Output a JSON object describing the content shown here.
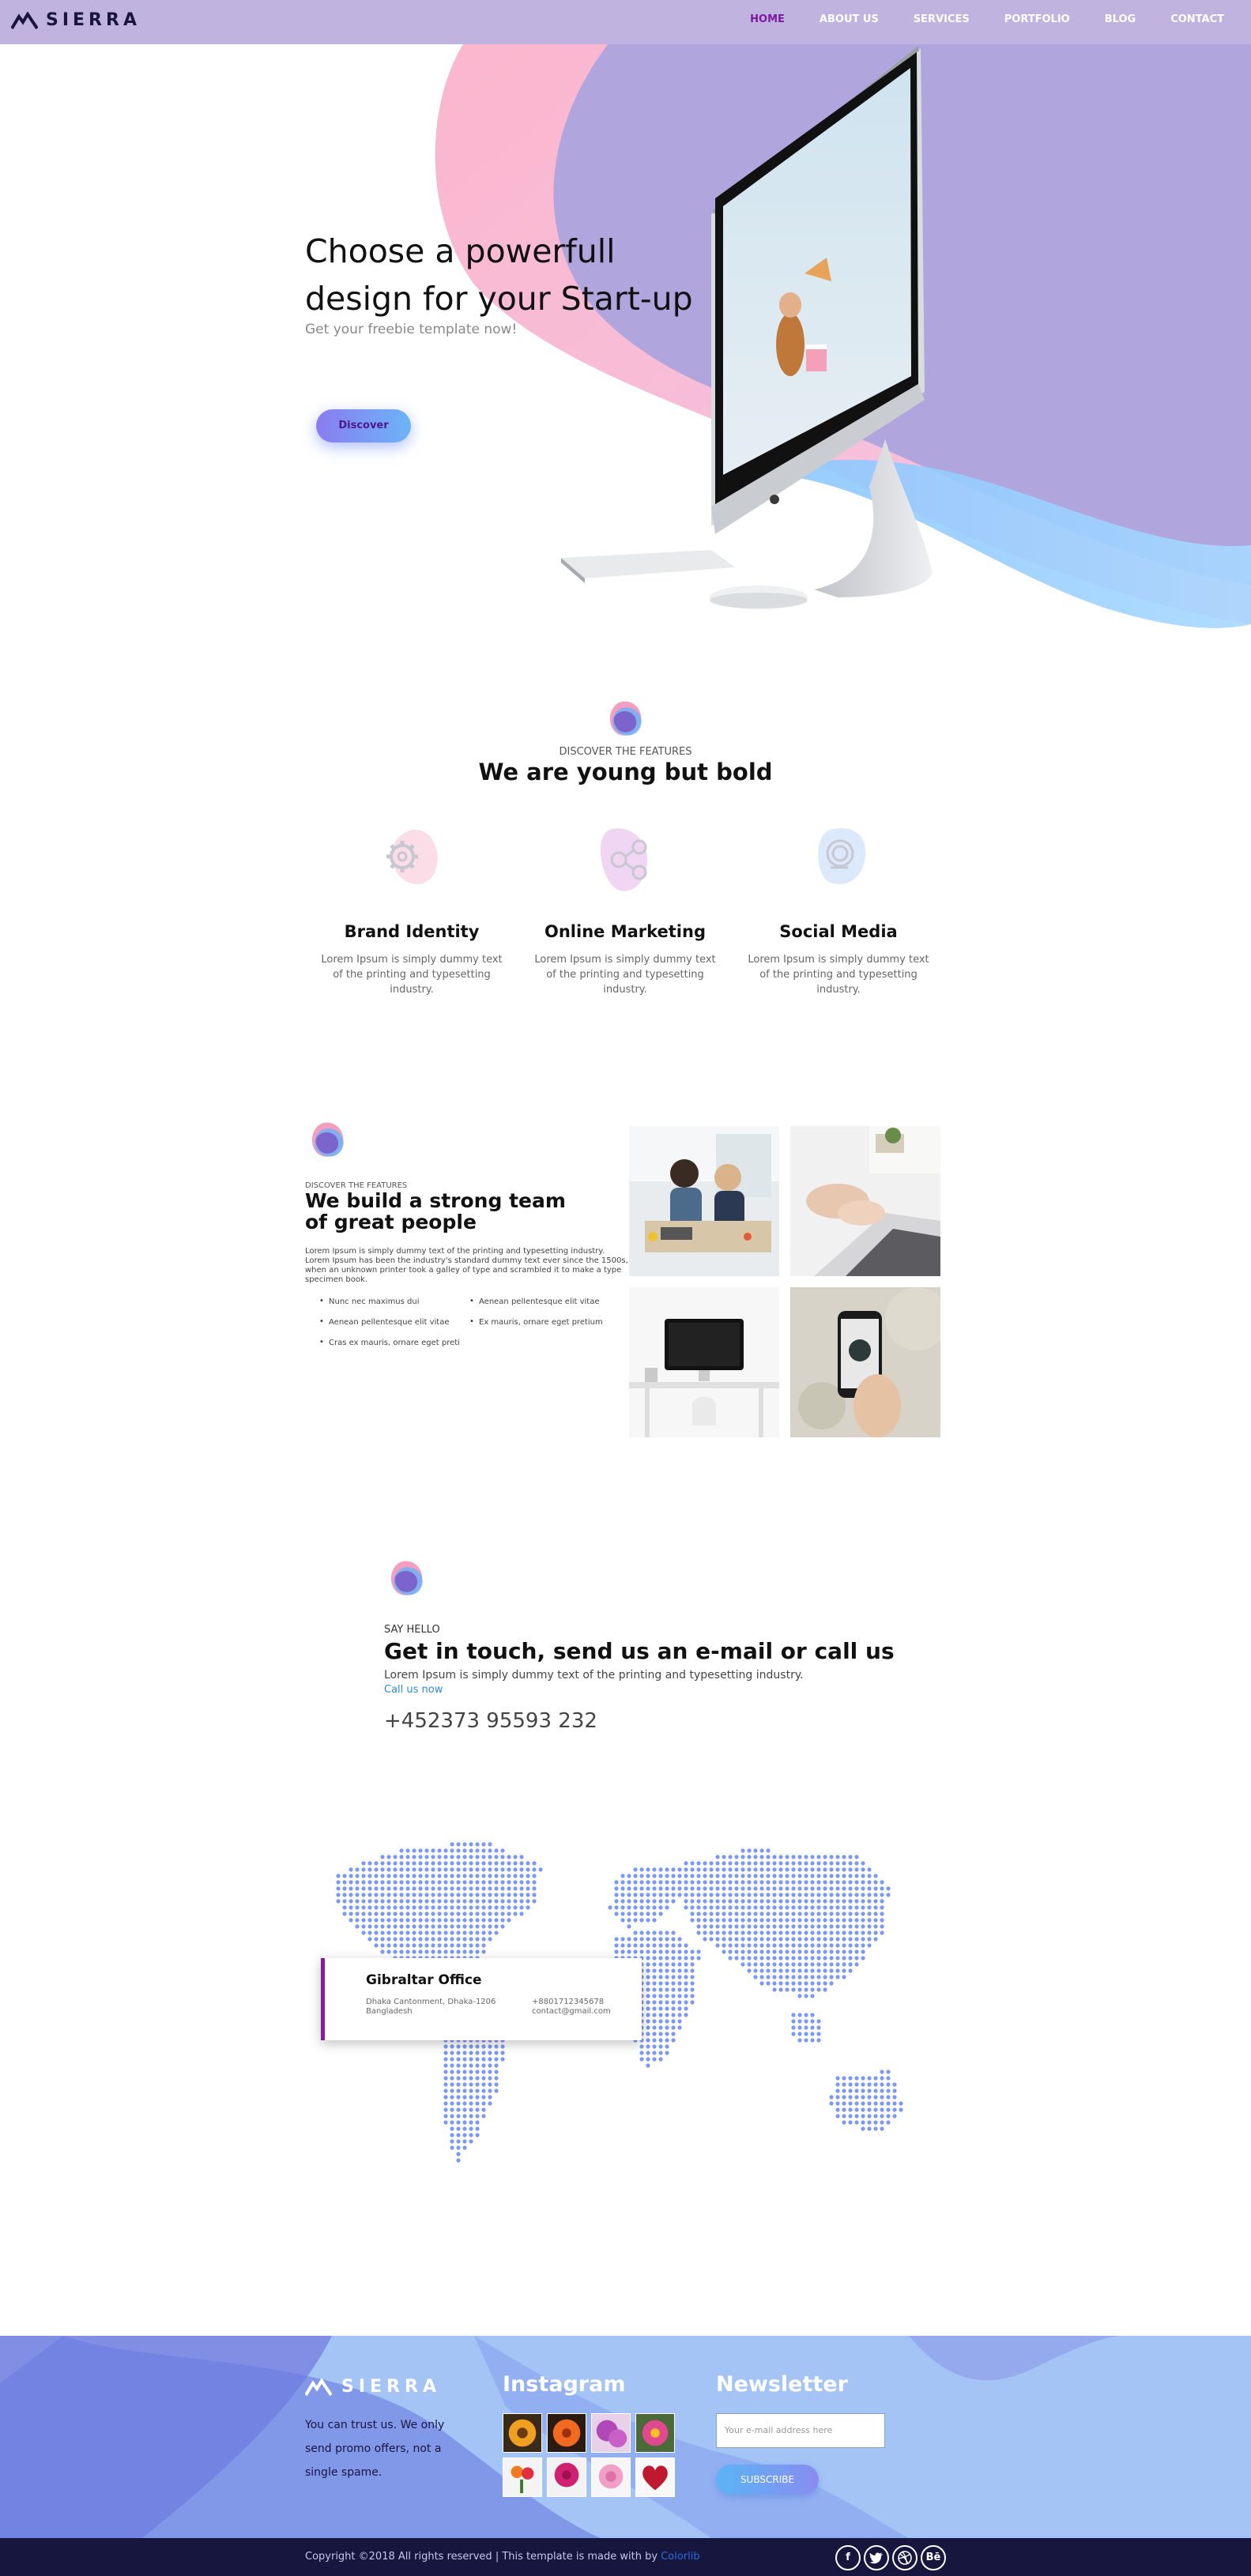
{
  "brand": {
    "name": "SIERRA",
    "logo_icon": "mountain-icon"
  },
  "nav": {
    "items": [
      "HOME",
      "ABOUT US",
      "SERVICES",
      "PORTFOLIO",
      "BLOG",
      "CONTACT"
    ],
    "active": "HOME"
  },
  "hero": {
    "title_line1": "Choose a powerfull",
    "title_line2": "design for your Start-up",
    "subtitle": "Get your freebie template now!",
    "button": "Discover"
  },
  "features": {
    "kicker": "DISCOVER THE FEATURES",
    "title": "We are young but bold",
    "items": [
      {
        "icon": "gear-icon",
        "title": "Brand Identity",
        "text": "Lorem Ipsum is simply dummy text of the printing and typesetting industry."
      },
      {
        "icon": "share-icon",
        "title": "Online Marketing",
        "text": "Lorem Ipsum is simply dummy text of the printing and typesetting industry."
      },
      {
        "icon": "social-icon",
        "title": "Social Media",
        "text": "Lorem Ipsum is simply dummy text of the printing and typesetting industry."
      }
    ]
  },
  "team": {
    "kicker": "DISCOVER THE FEATURES",
    "title_line1": "We build a strong team",
    "title_line2": "of great people",
    "text": "Lorem Ipsum is simply dummy text of the printing and typesetting industry. Lorem Ipsum has been the industry's standard dummy text ever since the 1500s, when an unknown printer took a galley of type and scrambled it to make a type specimen book.",
    "list": [
      "Nunc nec maximus dui",
      "Aenean pellentesque elit vitae",
      "Aenean pellentesque elit vitae",
      "Ex mauris, ornare eget pretium",
      "Cras ex mauris, ornare eget preti"
    ]
  },
  "contact": {
    "kicker": "SAY HELLO",
    "title": "Get in touch, send us an e-mail or call us",
    "text": "Lorem Ipsum is simply dummy text of the printing and typesetting industry.",
    "link": "Call us now",
    "phone": "+452373 95593 232"
  },
  "office": {
    "title": "Gibraltar Office",
    "address_line1": "Dhaka Cantonment, Dhaka-1206",
    "address_line2": "Bangladesh",
    "phone": "+8801712345678",
    "email": "contact@gmail.com"
  },
  "footer": {
    "logo": "SIERRA",
    "about": "You can trust us. We only send promo offers, not a single spame.",
    "instagram_title": "Instagram",
    "newsletter_title": "Newsletter",
    "email_placeholder": "Your e-mail address here",
    "subscribe": "SUBSCRIBE",
    "copyright": "Copyright ©2018 All rights reserved | This template is made with by ",
    "credit": "Colorlib",
    "socials": [
      "f",
      "t",
      "dribbble",
      "Bē"
    ]
  },
  "colors": {
    "topbar": "#c0b3e0",
    "accent": "#7a1a9e",
    "footer_bg": "#a3c4f5",
    "bottom_bar": "#16163f"
  }
}
